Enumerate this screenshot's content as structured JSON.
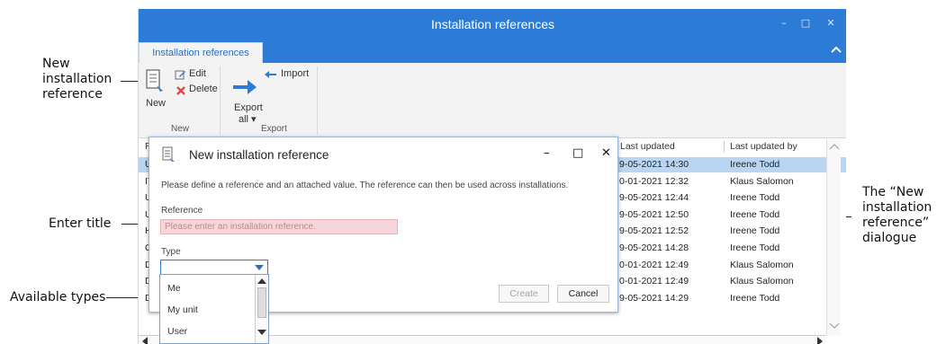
{
  "callouts": {
    "new_ref": [
      "New",
      "installation",
      "reference"
    ],
    "enter_title": "Enter title",
    "available_types": "Available types",
    "dialogue": [
      "The “New",
      "installation",
      "reference”",
      "dialogue"
    ]
  },
  "window": {
    "title": "Installation references",
    "controls": {
      "minimize": "–",
      "maximize": "□",
      "close": "✕"
    }
  },
  "ribbon": {
    "tab_label": "Installation references",
    "collapse_glyph": "^",
    "buttons": {
      "new": "New",
      "edit": "Edit",
      "delete": "Delete",
      "export_line1": "Export",
      "export_line2": "all ▾",
      "import": "Import"
    },
    "groups": {
      "new": "New",
      "export": "Export"
    }
  },
  "grid": {
    "columns": {
      "first": "R",
      "last_updated": "Last updated",
      "last_updated_by": "Last updated by"
    },
    "rows": [
      {
        "prefix": "U",
        "updated": "9-05-2021 14:30",
        "by": "Ireene Todd",
        "selected": true
      },
      {
        "prefix": "IT",
        "updated": "0-01-2021 12:32",
        "by": "Klaus Salomon",
        "selected": false
      },
      {
        "prefix": "U",
        "updated": "9-05-2021 12:44",
        "by": "Ireene Todd",
        "selected": false
      },
      {
        "prefix": "U",
        "updated": "9-05-2021 12:50",
        "by": "Ireene Todd",
        "selected": false
      },
      {
        "prefix": "H",
        "updated": "9-05-2021 12:52",
        "by": "Ireene Todd",
        "selected": false
      },
      {
        "prefix": "Q",
        "updated": "9-05-2021 14:28",
        "by": "Ireene Todd",
        "selected": false
      },
      {
        "prefix": "D",
        "updated": "0-01-2021 12:49",
        "by": "Klaus Salomon",
        "selected": false
      },
      {
        "prefix": "D",
        "updated": "0-01-2021 12:49",
        "by": "Klaus Salomon",
        "selected": false
      },
      {
        "prefix": "D",
        "updated": "9-05-2021 14:29",
        "by": "Ireene Todd",
        "selected": false
      }
    ]
  },
  "dialog": {
    "title": "New installation reference",
    "description": "Please define a reference and an attached value. The reference can then be used across installations.",
    "reference_label": "Reference",
    "reference_placeholder": "Please enter an installation reference.",
    "type_label": "Type",
    "type_value": "",
    "create_label": "Create",
    "cancel_label": "Cancel",
    "controls": {
      "minimize": "–",
      "maximize": "□",
      "close": "✕"
    }
  },
  "type_options": [
    "Me",
    "My unit",
    "User"
  ],
  "colors": {
    "accent": "#2b7bd7",
    "selection": "#b9d5f2",
    "required_field": "#f6d6da"
  }
}
